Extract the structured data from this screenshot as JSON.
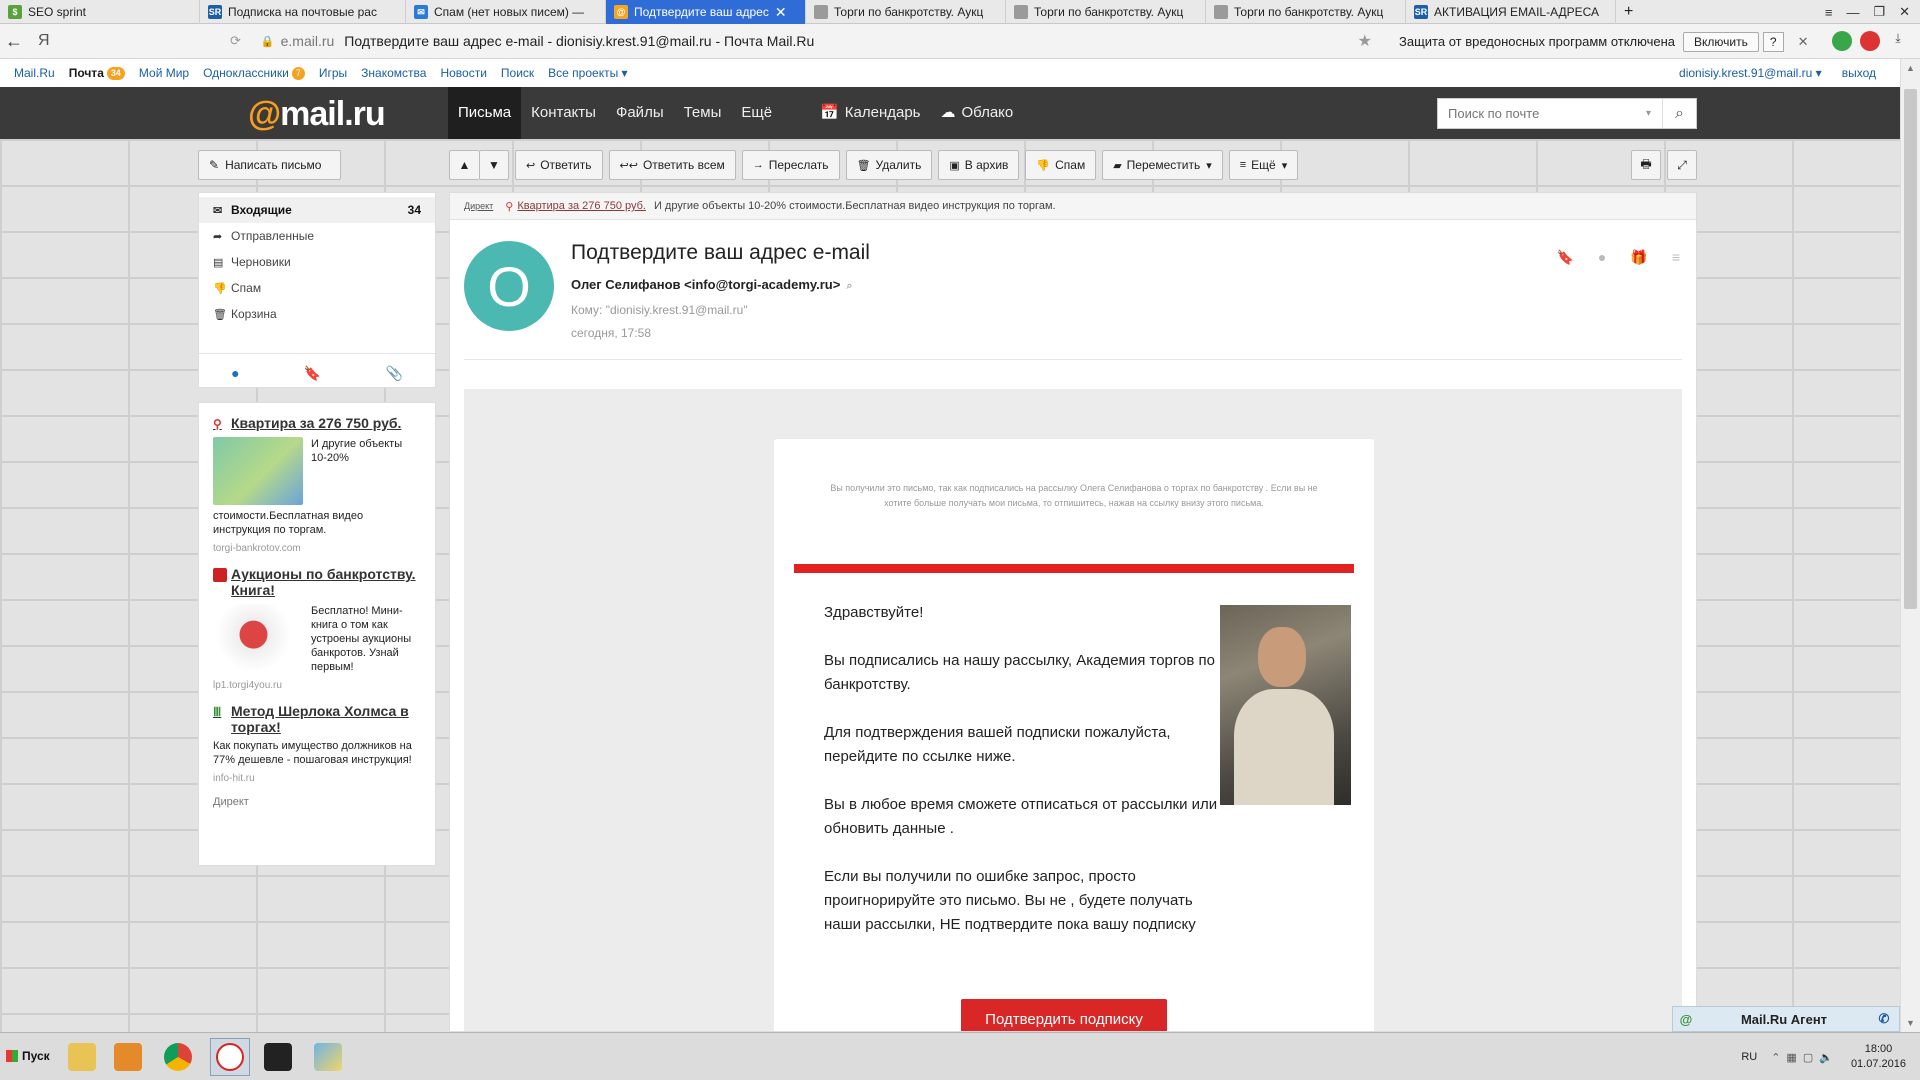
{
  "browser": {
    "tabs": [
      {
        "label": "SEO sprint",
        "icon_color": "#5aa33c",
        "icon_glyph": "$",
        "active": false
      },
      {
        "label": "Подписка на почтовые рас",
        "icon_color": "#1d5ea8",
        "icon_glyph": "SR",
        "active": false
      },
      {
        "label": "Спам (нет новых писем) —",
        "icon_color": "#2a7bd6",
        "icon_glyph": "✉",
        "active": false
      },
      {
        "label": "Подтвердите ваш адрес",
        "icon_color": "#f5a623",
        "icon_glyph": "@",
        "active": true
      },
      {
        "label": "Торги по банкротству. Аукц",
        "icon_color": "#9a9a9a",
        "icon_glyph": "",
        "active": false
      },
      {
        "label": "Торги по банкротству. Аукц",
        "icon_color": "#9a9a9a",
        "icon_glyph": "",
        "active": false
      },
      {
        "label": "Торги по банкротству. Аукц",
        "icon_color": "#9a9a9a",
        "icon_glyph": "",
        "active": false
      },
      {
        "label": "АКТИВАЦИЯ EMAIL-АДРЕСА",
        "icon_color": "#1d5ea8",
        "icon_glyph": "SR",
        "active": false
      }
    ],
    "new_tab": "+",
    "window_controls": [
      "≡",
      "—",
      "❐",
      "✕"
    ],
    "back": "←",
    "yandex": "Я",
    "url_domain": "e.mail.ru",
    "page_title": "Подтвердите ваш адрес e-mail - dionisiy.krest.91@mail.ru - Почта Mail.Ru",
    "protection_text": "Защита от вредоносных программ отключена",
    "protection_button": "Включить",
    "protection_help": "?",
    "protection_close": "✕"
  },
  "portal": {
    "links": [
      "Mail.Ru",
      "Почта",
      "Мой Мир",
      "Одноклассники",
      "Игры",
      "Знакомства",
      "Новости",
      "Поиск",
      "Все проекты ▾"
    ],
    "mail_badge": "34",
    "ok_badge": "7",
    "user": "dionisiy.krest.91@mail.ru ▾",
    "logout": "выход"
  },
  "header": {
    "logo_at": "@",
    "logo_text": "mail.ru",
    "nav": [
      "Письма",
      "Контакты",
      "Файлы",
      "Темы",
      "Ещё"
    ],
    "calendar": "Календарь",
    "cloud": "Облако",
    "search_placeholder": "Поиск по почте"
  },
  "compose": {
    "label": "Написать письмо"
  },
  "toolbar": {
    "reply": "Ответить",
    "reply_all": "Ответить всем",
    "forward": "Переслать",
    "delete": "Удалить",
    "archive": "В архив",
    "spam": "Спам",
    "move": "Переместить",
    "more": "Ещё"
  },
  "folders": [
    {
      "label": "Входящие",
      "count": "34",
      "icon": "✉"
    },
    {
      "label": "Отправленные",
      "count": "",
      "icon": "➦"
    },
    {
      "label": "Черновики",
      "count": "",
      "icon": "▤"
    },
    {
      "label": "Спам",
      "count": "",
      "icon": "👎"
    },
    {
      "label": "Корзина",
      "count": "",
      "icon": "🗑"
    }
  ],
  "ads": {
    "items": [
      {
        "title": "Квартира за 276 750 руб.",
        "text": "И другие объекты 10-20%",
        "text2": "стоимости.Бесплатная видео инструкция по торгам.",
        "source": "torgi-bankrotov.com"
      },
      {
        "title": "Аукционы по банкротству. Книга!",
        "text": "Бесплатно! Мини-книга о том как устроены аукционы банкротов. Узнай первым!",
        "text2": "",
        "source": "lp1.torgi4you.ru"
      },
      {
        "title": "Метод Шерлока Холмса в торгах!",
        "text": "",
        "text2": "Как покупать имущество должников на 77% дешевле - пошаговая инструкция!",
        "source": "info-hit.ru"
      }
    ],
    "footer": "Директ"
  },
  "message": {
    "ad_label": "Директ",
    "ad_link": "Квартира за 276 750 руб.",
    "ad_text": "И другие объекты 10-20% стоимости.Бесплатная видео инструкция по торгам.",
    "avatar_letter": "О",
    "subject": "Подтвердите ваш адрес e-mail",
    "from": "Олег Селифанов <info@torgi-academy.ru>",
    "to": "Кому: \"dionisiy.krest.91@mail.ru\"",
    "date": "сегодня, 17:58",
    "notice": "Вы получили это письмо, так как подписались на рассылку Олега Селифанова о торгах по банкротству . Если вы не хотите больше получать мои письма, то отпишитесь, нажав на ссылку внизу этого письма.",
    "paragraphs": [
      "Здравствуйте!",
      "Вы подписались на нашу рассылку, Академия торгов по банкротству.",
      "Для подтверждения вашей подписки пожалуйста, перейдите по ссылке ниже.",
      "Вы в любое время сможете отписаться от рассылки или обновить данные .",
      "Если вы получили по ошибке запрос, просто проигнорируйте это письмо. Вы не , будете получать наши рассылки, НЕ подтвердите пока вашу подписку"
    ],
    "cta": "Подтвердить подписку"
  },
  "agent": {
    "label": "Mail.Ru Агент"
  },
  "taskbar": {
    "start": "Пуск",
    "lang": "RU",
    "time": "18:00",
    "date": "01.07.2016"
  },
  "colors": {
    "accent_red": "#e32120",
    "avatar_teal": "#4cb8b2",
    "header_dark": "#3a3a3a",
    "logo_orange": "#f99d1c"
  }
}
